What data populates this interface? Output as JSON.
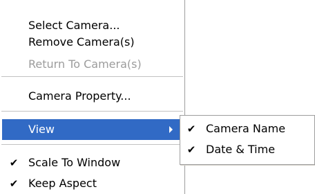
{
  "main_menu": {
    "items": [
      {
        "label": "Select Camera..."
      },
      {
        "label": "Remove Camera(s)"
      },
      {
        "label": "Return To Camera(s)"
      },
      {
        "label": "Camera Property..."
      },
      {
        "label": "View"
      },
      {
        "label": "Scale To Window",
        "check": "✔"
      },
      {
        "label": "Keep Aspect",
        "check": "✔"
      }
    ]
  },
  "view_submenu": {
    "items": [
      {
        "label": "Camera Name",
        "check": "✔"
      },
      {
        "label": "Date & Time",
        "check": "✔"
      }
    ]
  },
  "colors": {
    "highlight": "#316ac5",
    "disabled_text": "#9c9c9c"
  },
  "icons": {
    "check": "checkmark-icon",
    "submenu_arrow": "chevron-right-icon"
  }
}
